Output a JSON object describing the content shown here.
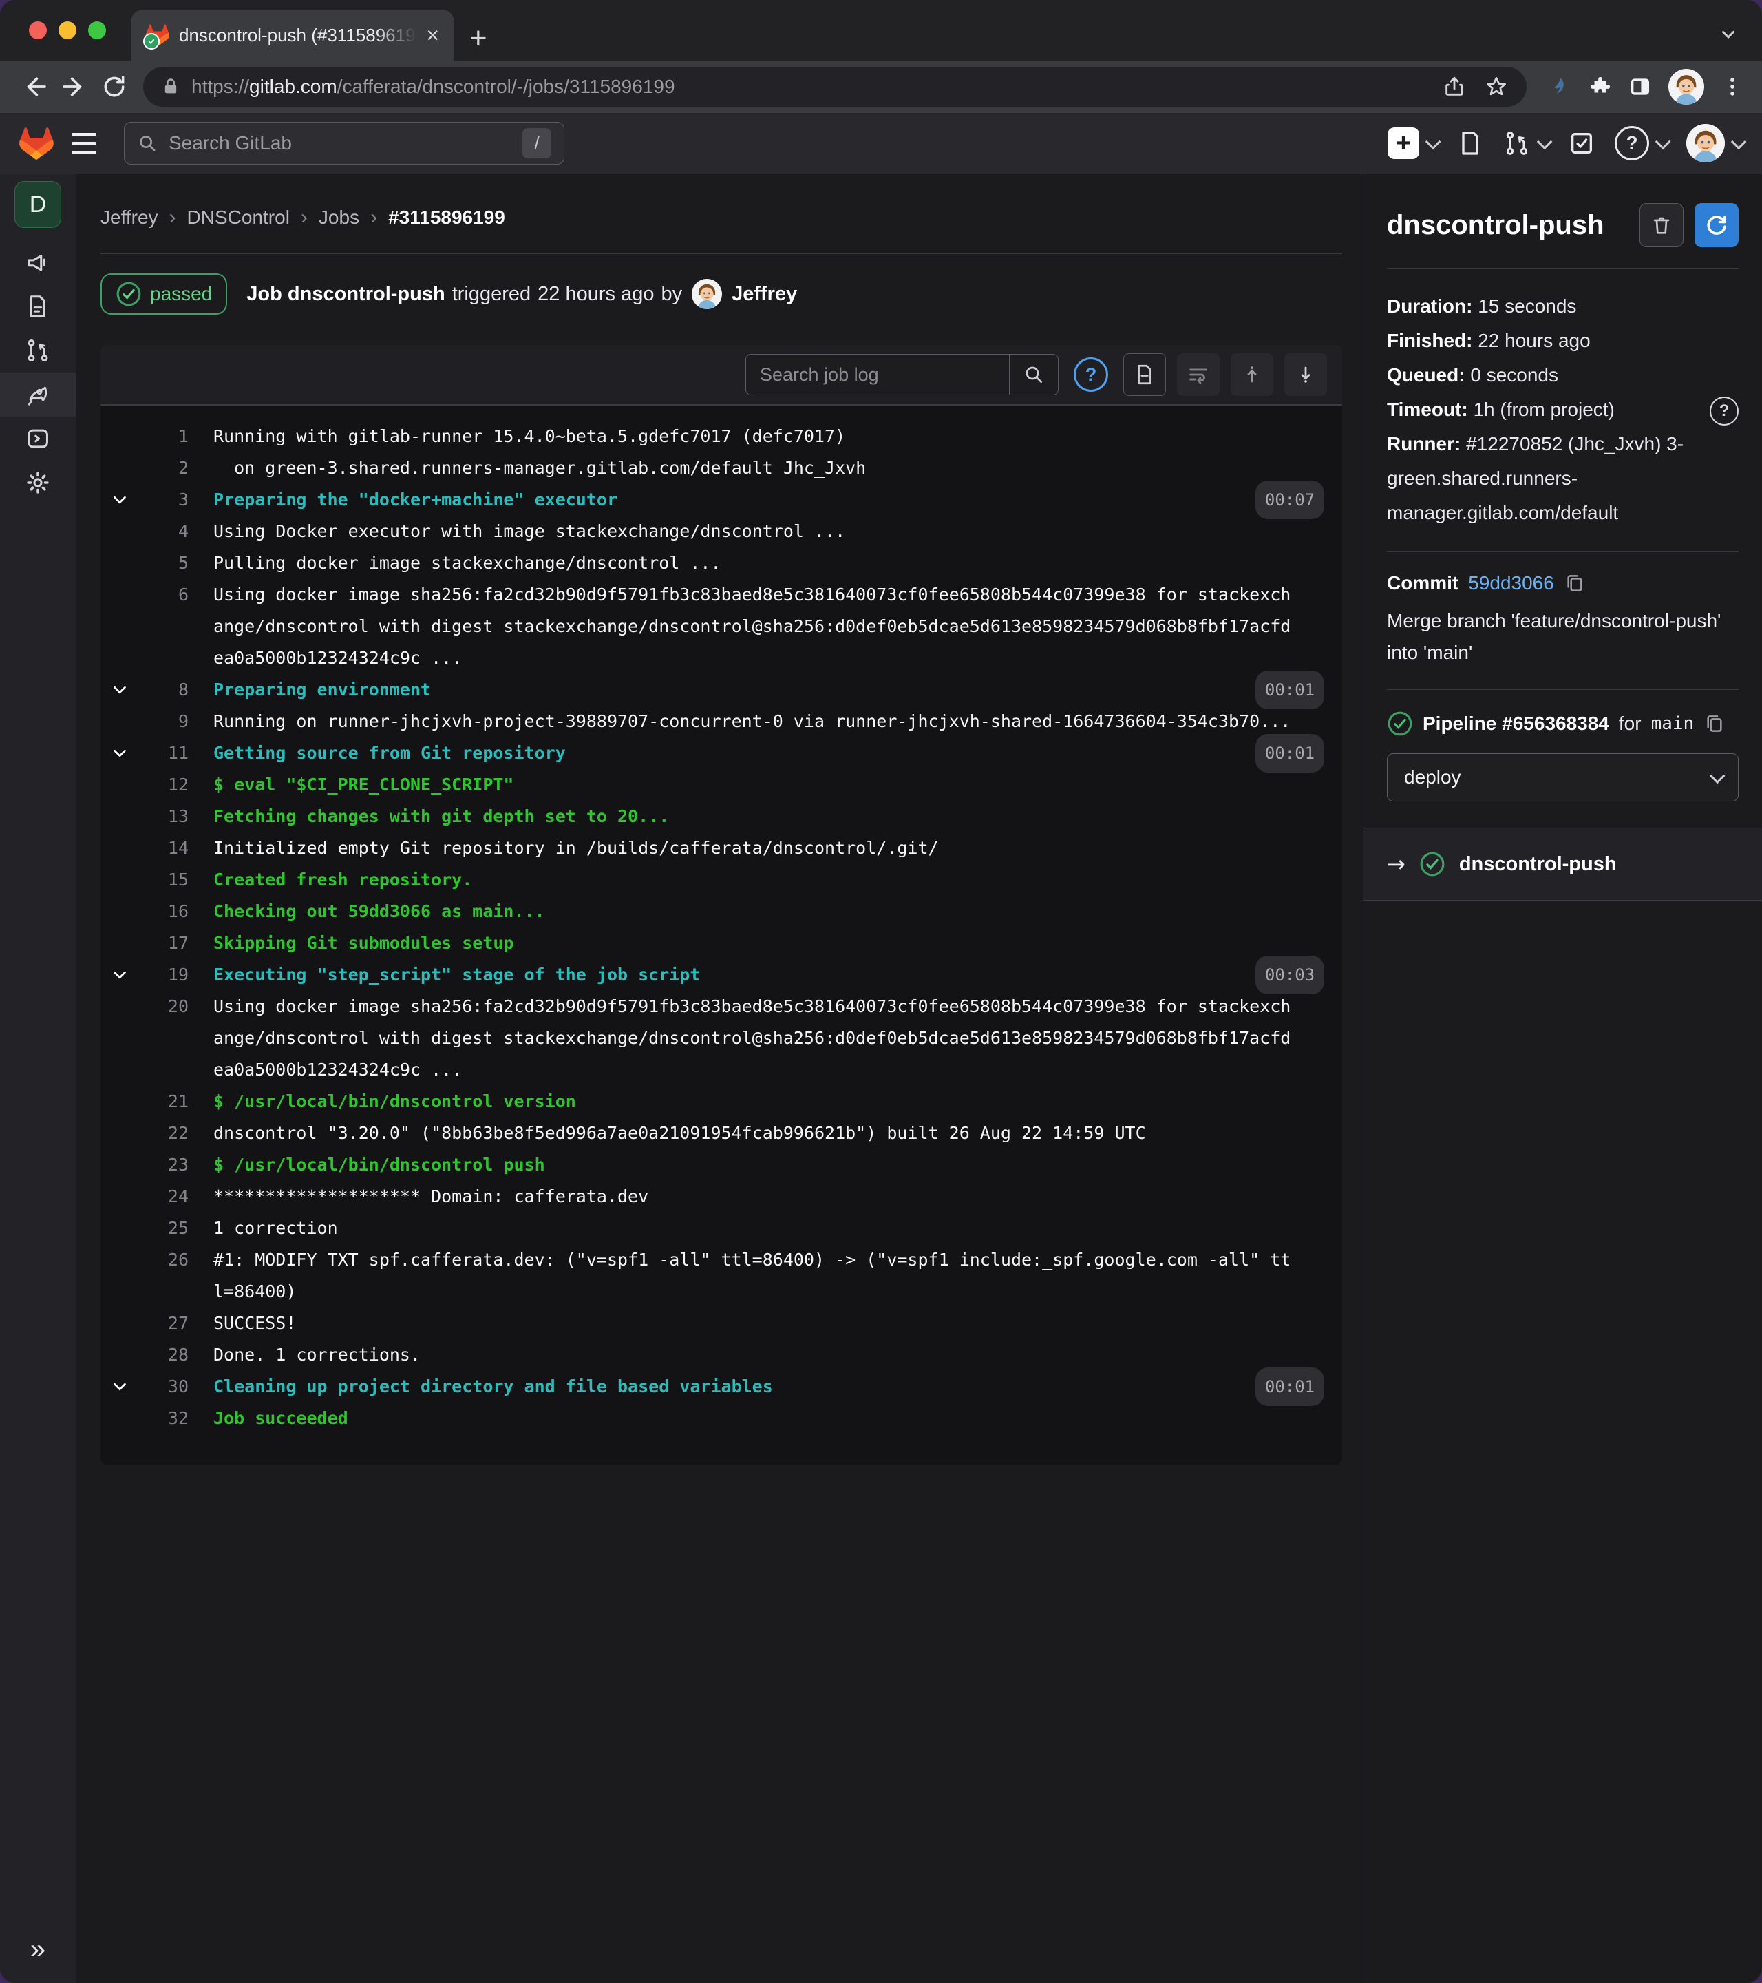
{
  "browser": {
    "tab": {
      "title": "dnscontrol-push (#311589619",
      "close": "×",
      "new_tab": "+"
    },
    "url": {
      "scheme": "https://",
      "host": "gitlab.com",
      "path": "/cafferata/dnscontrol/-/jobs/3115896199"
    }
  },
  "gitlab_header": {
    "search_placeholder": "Search GitLab",
    "search_shortcut": "/"
  },
  "left_sidebar": {
    "project_initial": "D",
    "expand_glyph": "»"
  },
  "breadcrumb": {
    "items": [
      {
        "label": "Jeffrey"
      },
      {
        "label": "DNSControl"
      },
      {
        "label": "Jobs"
      },
      {
        "label": "#3115896199"
      }
    ]
  },
  "job_header": {
    "status": "passed",
    "prefix": "Job",
    "job_name": "dnscontrol-push",
    "middle": "triggered",
    "time": "22 hours ago",
    "by": "by",
    "author": "Jeffrey"
  },
  "log": {
    "search_placeholder": "Search job log",
    "lines": [
      {
        "n": 1,
        "type": "plain",
        "t": "Running with gitlab-runner 15.4.0~beta.5.gdefc7017 (defc7017)"
      },
      {
        "n": 2,
        "type": "plain",
        "t": "  on green-3.shared.runners-manager.gitlab.com/default Jhc_Jxvh"
      },
      {
        "n": 3,
        "type": "section",
        "t": "Preparing the \"docker+machine\" executor",
        "d": "00:07"
      },
      {
        "n": 4,
        "type": "plain",
        "t": "Using Docker executor with image stackexchange/dnscontrol ..."
      },
      {
        "n": 5,
        "type": "plain",
        "t": "Pulling docker image stackexchange/dnscontrol ..."
      },
      {
        "n": 6,
        "type": "plain",
        "t": "Using docker image sha256:fa2cd32b90d9f5791fb3c83baed8e5c381640073cf0fee65808b544c07399e38 for stackexchange/dnscontrol with digest stackexchange/dnscontrol@sha256:d0def0eb5dcae5d613e8598234579d068b8fbf17acfdea0a5000b12324324c9c ..."
      },
      {
        "n": 8,
        "type": "section",
        "t": "Preparing environment",
        "d": "00:01"
      },
      {
        "n": 9,
        "type": "plain",
        "t": "Running on runner-jhcjxvh-project-39889707-concurrent-0 via runner-jhcjxvh-shared-1664736604-354c3b70..."
      },
      {
        "n": 11,
        "type": "section",
        "t": "Getting source from Git repository",
        "d": "00:01"
      },
      {
        "n": 12,
        "type": "green",
        "t": "$ eval \"$CI_PRE_CLONE_SCRIPT\""
      },
      {
        "n": 13,
        "type": "green",
        "t": "Fetching changes with git depth set to 20..."
      },
      {
        "n": 14,
        "type": "plain",
        "t": "Initialized empty Git repository in /builds/cafferata/dnscontrol/.git/"
      },
      {
        "n": 15,
        "type": "green",
        "t": "Created fresh repository."
      },
      {
        "n": 16,
        "type": "green",
        "t": "Checking out 59dd3066 as main..."
      },
      {
        "n": 17,
        "type": "green",
        "t": "Skipping Git submodules setup"
      },
      {
        "n": 19,
        "type": "section",
        "t": "Executing \"step_script\" stage of the job script",
        "d": "00:03"
      },
      {
        "n": 20,
        "type": "plain",
        "t": "Using docker image sha256:fa2cd32b90d9f5791fb3c83baed8e5c381640073cf0fee65808b544c07399e38 for stackexchange/dnscontrol with digest stackexchange/dnscontrol@sha256:d0def0eb5dcae5d613e8598234579d068b8fbf17acfdea0a5000b12324324c9c ..."
      },
      {
        "n": 21,
        "type": "green",
        "t": "$ /usr/local/bin/dnscontrol version"
      },
      {
        "n": 22,
        "type": "plain",
        "t": "dnscontrol \"3.20.0\" (\"8bb63be8f5ed996a7ae0a21091954fcab996621b\") built 26 Aug 22 14:59 UTC"
      },
      {
        "n": 23,
        "type": "green",
        "t": "$ /usr/local/bin/dnscontrol push"
      },
      {
        "n": 24,
        "type": "plain",
        "t": "******************** Domain: cafferata.dev"
      },
      {
        "n": 25,
        "type": "plain",
        "t": "1 correction"
      },
      {
        "n": 26,
        "type": "plain",
        "t": "#1: MODIFY TXT spf.cafferata.dev: (\"v=spf1 -all\" ttl=86400) -> (\"v=spf1 include:_spf.google.com -all\" ttl=86400)"
      },
      {
        "n": 27,
        "type": "plain",
        "t": "SUCCESS!"
      },
      {
        "n": 28,
        "type": "plain",
        "t": "Done. 1 corrections."
      },
      {
        "n": 30,
        "type": "section",
        "t": "Cleaning up project directory and file based variables",
        "d": "00:01"
      },
      {
        "n": 32,
        "type": "green",
        "t": "Job succeeded"
      }
    ]
  },
  "sidebar": {
    "title": "dnscontrol-push",
    "details": [
      {
        "label": "Duration",
        "value": "15 seconds"
      },
      {
        "label": "Finished",
        "value": "22 hours ago"
      },
      {
        "label": "Queued",
        "value": "0 seconds"
      },
      {
        "label": "Timeout",
        "value": "1h (from project)",
        "help": true
      },
      {
        "label": "Runner",
        "value": "#12270852 (Jhc_Jxvh) 3-green.shared.runners-manager.gitlab.com/default"
      }
    ],
    "commit": {
      "label": "Commit",
      "sha": "59dd3066",
      "message": "Merge branch 'feature/dnscontrol-push' into 'main'"
    },
    "pipeline": {
      "label": "Pipeline",
      "id": "#656368384",
      "for_word": "for",
      "ref": "main"
    },
    "stage_select": {
      "value": "deploy"
    },
    "job_item": {
      "arrow": "→",
      "name": "dnscontrol-push"
    }
  },
  "colors": {
    "accent_blue": "#2f7fd6",
    "link_blue": "#6cb2f5",
    "success_green": "#3f9e66",
    "log_teal": "#29bdbd",
    "log_green": "#2ec52e"
  }
}
